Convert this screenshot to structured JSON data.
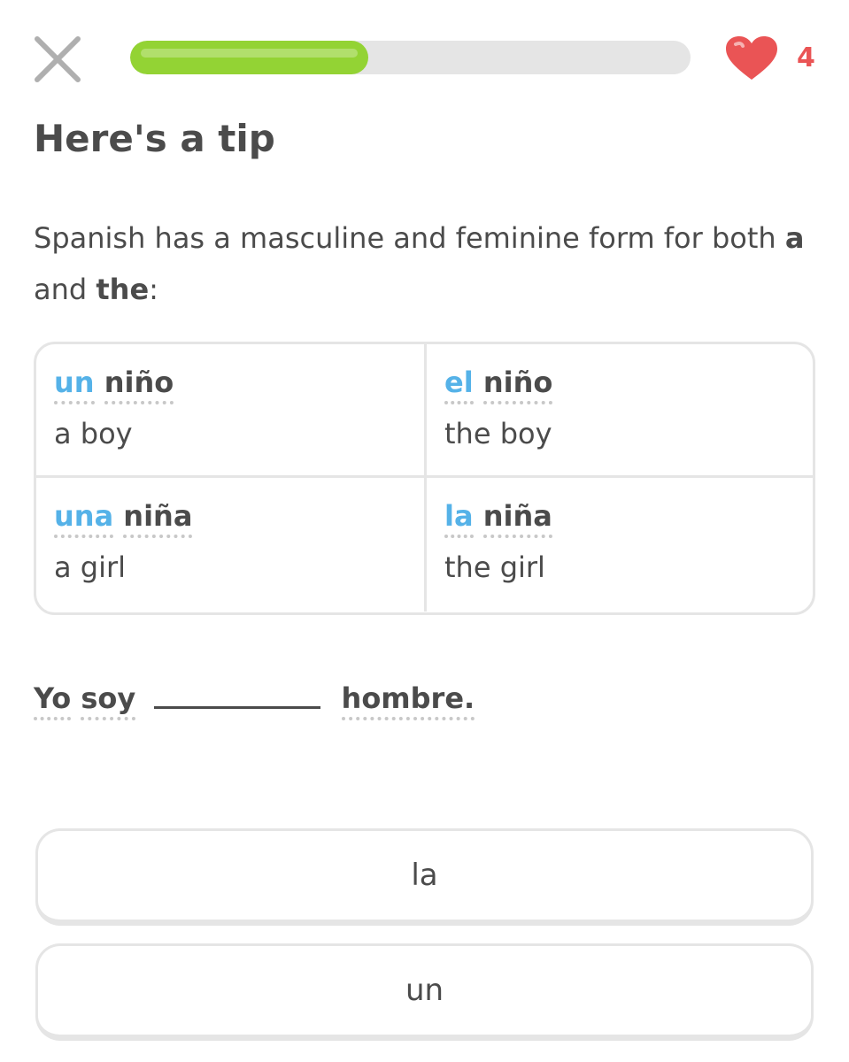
{
  "header": {
    "close_icon": "close-icon",
    "progress_fraction": 0.425,
    "hearts_icon": "heart-icon",
    "hearts_count": "4"
  },
  "title": "Here's a tip",
  "tip": {
    "part1": "Spanish has a masculine and feminine form for both ",
    "bold_a": "a",
    "part2": " and ",
    "bold_the": "the",
    "part3": ":"
  },
  "grammar_table": [
    {
      "article": "un",
      "noun": "niño",
      "translation": "a boy"
    },
    {
      "article": "el",
      "noun": "niño",
      "translation": "the boy"
    },
    {
      "article": "una",
      "noun": "niña",
      "translation": "a girl"
    },
    {
      "article": "la",
      "noun": "niña",
      "translation": "the girl"
    }
  ],
  "sentence": {
    "word1": "Yo",
    "word2": "soy",
    "word3": "hombre."
  },
  "options": [
    {
      "label": "la"
    },
    {
      "label": "un"
    }
  ],
  "colors": {
    "progress_green": "#93d334",
    "article_blue": "#55b2e8",
    "heart_red": "#ea5455",
    "text_gray": "#4b4b4b",
    "border_gray": "#e5e5e5"
  }
}
